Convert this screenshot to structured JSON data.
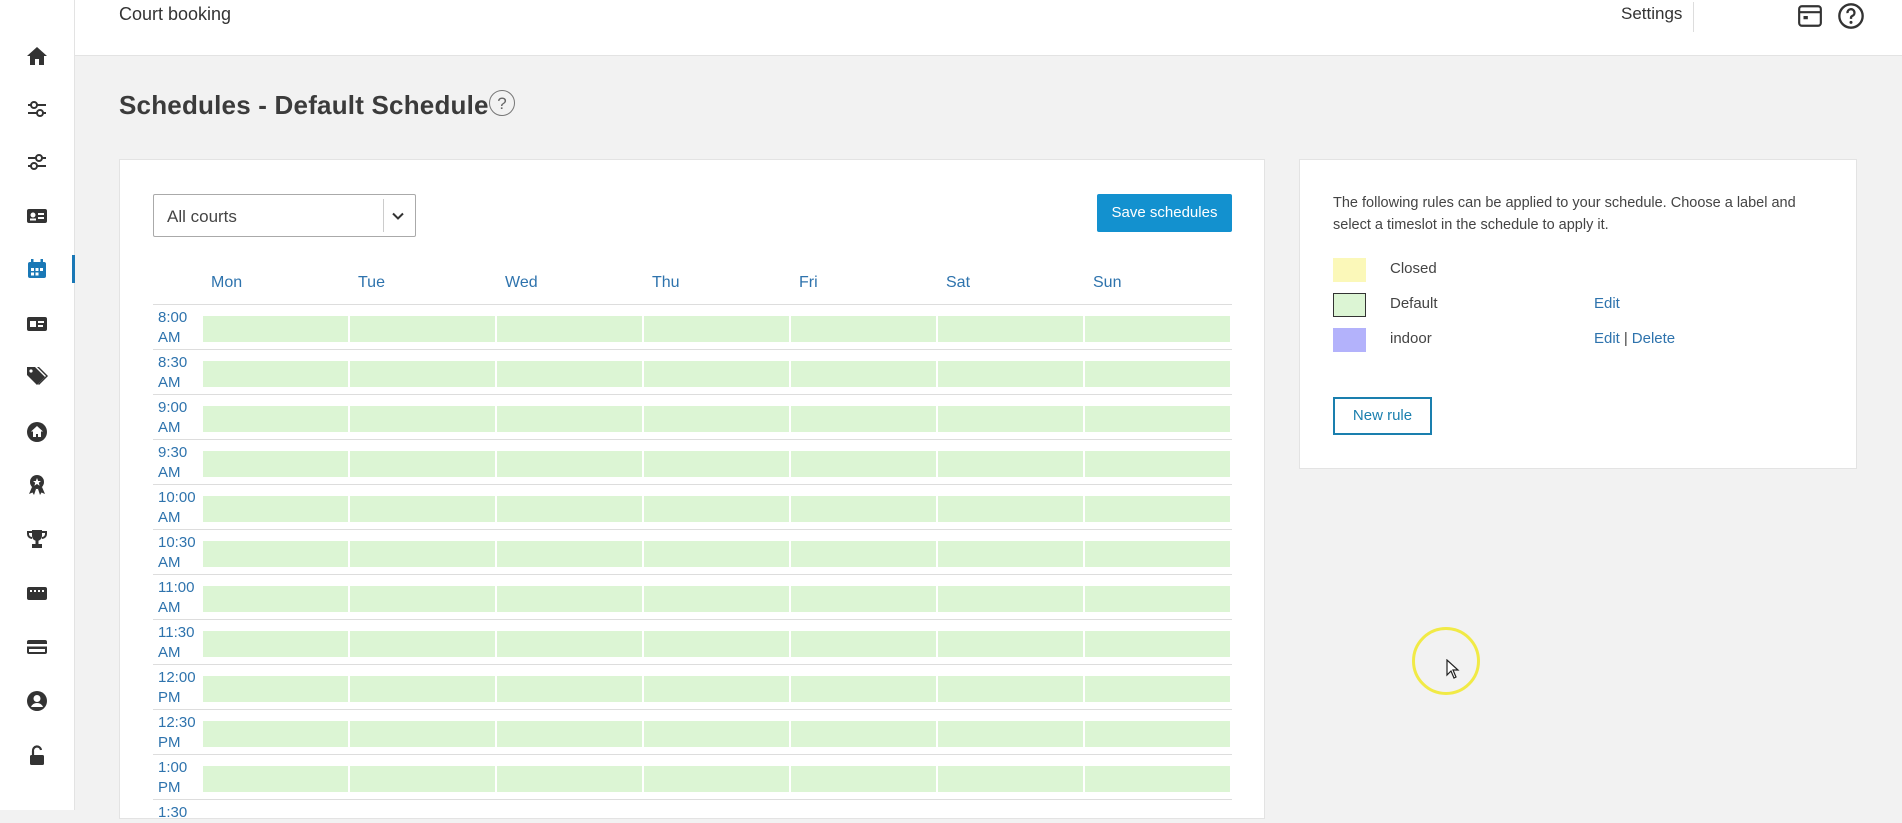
{
  "app": {
    "title": "Court booking",
    "settings_label": "Settings"
  },
  "page": {
    "title": "Schedules - Default Schedule",
    "help_glyph": "?"
  },
  "sidebar": {
    "items": [
      {
        "icon": "home-icon",
        "active": false
      },
      {
        "icon": "sliders-icon",
        "active": false
      },
      {
        "icon": "sliders-icon",
        "active": false
      },
      {
        "icon": "contact-card-icon",
        "active": false
      },
      {
        "icon": "calendar-icon",
        "active": true
      },
      {
        "icon": "id-card-icon",
        "active": false
      },
      {
        "icon": "tags-icon",
        "active": false
      },
      {
        "icon": "home-circle-icon",
        "active": false
      },
      {
        "icon": "award-icon",
        "active": false
      },
      {
        "icon": "trophy-icon",
        "active": false
      },
      {
        "icon": "ticket-icon",
        "active": false
      },
      {
        "icon": "credit-card-icon",
        "active": false
      },
      {
        "icon": "user-circle-icon",
        "active": false
      },
      {
        "icon": "lock-icon",
        "active": false
      }
    ]
  },
  "schedule": {
    "court_select": {
      "value": "All courts"
    },
    "save_label": "Save schedules",
    "days": [
      "Mon",
      "Tue",
      "Wed",
      "Thu",
      "Fri",
      "Sat",
      "Sun"
    ],
    "times": [
      {
        "top": "8:00",
        "bottom": "AM"
      },
      {
        "top": "8:30",
        "bottom": "AM"
      },
      {
        "top": "9:00",
        "bottom": "AM"
      },
      {
        "top": "9:30",
        "bottom": "AM"
      },
      {
        "top": "10:00",
        "bottom": "AM"
      },
      {
        "top": "10:30",
        "bottom": "AM"
      },
      {
        "top": "11:00",
        "bottom": "AM"
      },
      {
        "top": "11:30",
        "bottom": "AM"
      },
      {
        "top": "12:00",
        "bottom": "PM"
      },
      {
        "top": "12:30",
        "bottom": "PM"
      },
      {
        "top": "1:00",
        "bottom": "PM"
      },
      {
        "top": "1:30",
        "bottom": ""
      }
    ],
    "slot_rule": "Default"
  },
  "rules": {
    "intro": "The following rules can be applied to your schedule. Choose a label and select a timeslot in the schedule to apply it.",
    "items": [
      {
        "label": "Closed",
        "color": "#fbf8b9",
        "bordered": false,
        "edit": "",
        "delete": ""
      },
      {
        "label": "Default",
        "color": "#dcf5d4",
        "bordered": true,
        "edit": "Edit",
        "delete": ""
      },
      {
        "label": "indoor",
        "color": "#b3b2fb",
        "bordered": false,
        "edit": "Edit",
        "delete": "Delete"
      }
    ],
    "new_rule_label": "New rule"
  },
  "colors": {
    "accent": "#1391cf",
    "link": "#2e73ad",
    "default_slot": "#dcf5d4"
  }
}
